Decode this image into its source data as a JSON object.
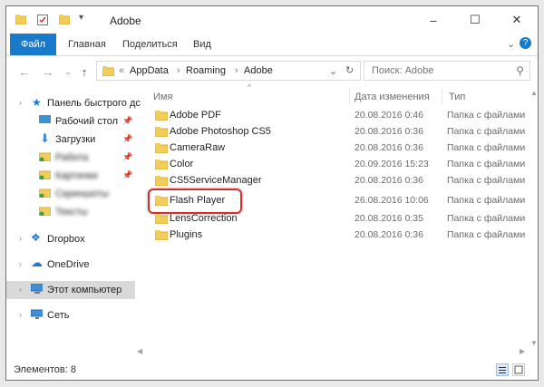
{
  "window": {
    "title": "Adobe",
    "close": "✕",
    "minimize": "–",
    "maximize": "☐"
  },
  "ribbon": {
    "tabs": [
      "Файл",
      "Главная",
      "Поделиться",
      "Вид"
    ],
    "expand": "⌄",
    "help": "?"
  },
  "address": {
    "overflow": "«",
    "crumbs": [
      "AppData",
      "Roaming",
      "Adobe"
    ],
    "sep": "›",
    "refresh": "↻",
    "dropdown": "⌄"
  },
  "search": {
    "placeholder": "Поиск: Adobe"
  },
  "nav": {
    "quick_access": "Панель быстрого дс",
    "items": [
      {
        "label": "Рабочий стол",
        "blurred": false
      },
      {
        "label": "Загрузки",
        "blurred": false
      },
      {
        "label": "Работа",
        "blurred": true
      },
      {
        "label": "Картинки",
        "blurred": true
      },
      {
        "label": "Скриншоты",
        "blurred": true
      },
      {
        "label": "Тексты",
        "blurred": true
      }
    ],
    "dropbox": "Dropbox",
    "onedrive": "OneDrive",
    "this_pc": "Этот компьютер",
    "network": "Сеть"
  },
  "columns": {
    "name": "Имя",
    "date": "Дата изменения",
    "type": "Тип"
  },
  "files": [
    {
      "name": "Adobe PDF",
      "date": "20.08.2016 0:46",
      "type": "Папка с файлами"
    },
    {
      "name": "Adobe Photoshop CS5",
      "date": "20.08.2016 0:36",
      "type": "Папка с файлами"
    },
    {
      "name": "CameraRaw",
      "date": "20.08.2016 0:36",
      "type": "Папка с файлами"
    },
    {
      "name": "Color",
      "date": "20.09.2016 15:23",
      "type": "Папка с файлами"
    },
    {
      "name": "CS5ServiceManager",
      "date": "20.08.2016 0:36",
      "type": "Папка с файлами"
    },
    {
      "name": "Flash Player",
      "date": "26.08.2016 10:06",
      "type": "Папка с файлами"
    },
    {
      "name": "LensCorrection",
      "date": "20.08.2016 0:35",
      "type": "Папка с файлами"
    },
    {
      "name": "Plugins",
      "date": "20.08.2016 0:36",
      "type": "Папка с файлами"
    }
  ],
  "status": {
    "items": "Элементов: 8"
  },
  "colors": {
    "accent": "#1979ca",
    "folder": "#f3cd5a",
    "highlight": "#d62d2d"
  }
}
